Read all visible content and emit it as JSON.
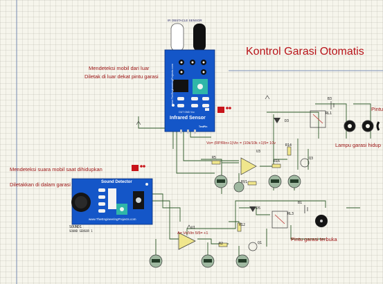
{
  "title": "Kontrol Garasi Otomatis",
  "annotations": {
    "ir_line1": "Mendeteksi mobil dari luar",
    "ir_line2": "Diletak di luar dekat pintu garasi",
    "sound_line1": "Mendeteksi suara mobil saat dihidupkan",
    "sound_line2": "Diletakkan di dalam garasi",
    "lamp_label": "Lampu garasi hidup",
    "door_label": "Pintu garasi terbuka",
    "right_cut": "Pintu ga"
  },
  "formulas": {
    "upper": "Vo= (RP/Rin+1)Vin = (10k/10k +1)5= 10v",
    "lower": "A= Vo/Vin  5/5= +1"
  },
  "ir_sensor": {
    "name": "Infrared Sensor",
    "site": "www.TheEngineeringProjects.com",
    "pins": "OUT GND Vcc",
    "top_caption": "IR OBSTACLE SENSOR",
    "tag": "TestPin"
  },
  "sound_sensor": {
    "name": "Sound Detector",
    "site": "www.TheEngineeringProjects.com",
    "ref": "SOUND1",
    "sub": "SOUND SENSOR 1"
  },
  "components": {
    "u3": "U3",
    "u1": "U1",
    "r5": "R5",
    "r16": "R16",
    "r14": "R14",
    "r12": "R12",
    "r2": "R2",
    "rv": "RV1",
    "q3": "Q3",
    "q1": "Q1",
    "d3": "D3",
    "d5": "D5",
    "b3": "B3",
    "b1": "B1",
    "rl1": "RL1",
    "rl3": "RL3"
  }
}
